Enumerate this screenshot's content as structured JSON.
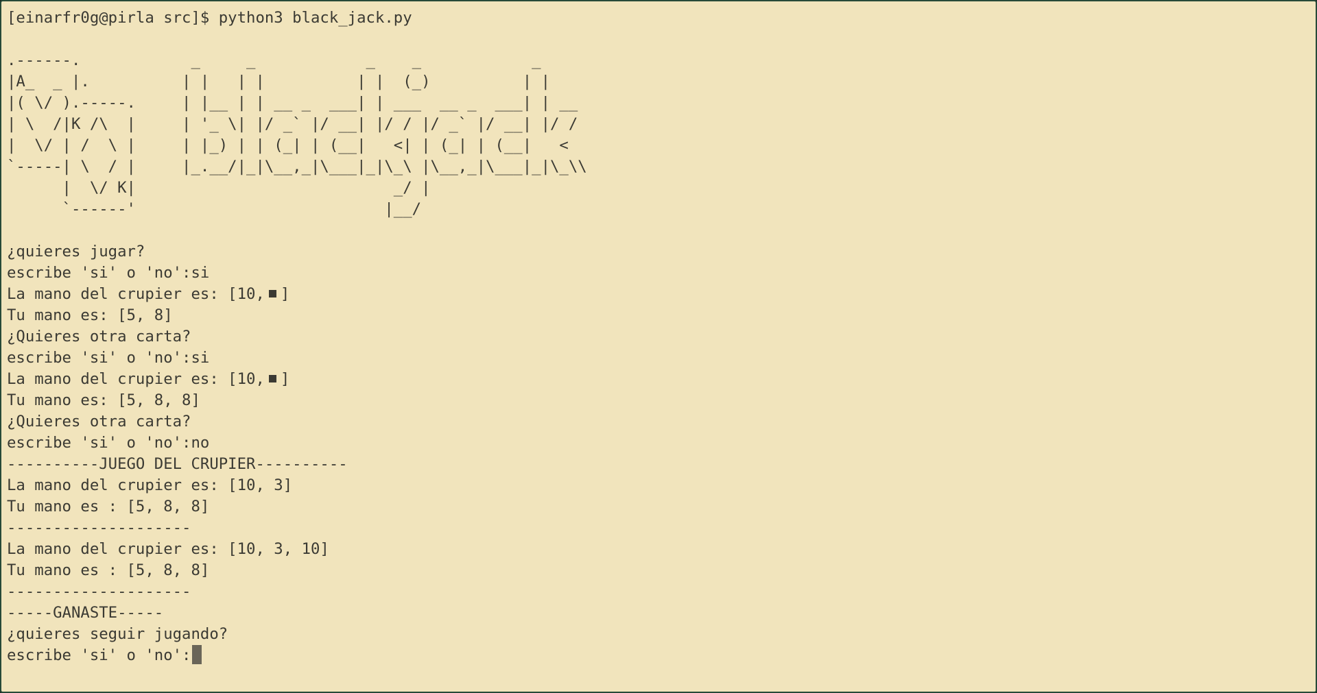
{
  "command_line": "[einarfr0g@pirla src]$ python3 black_jack.py",
  "banner": [
    ".------.            _     _            _    _            _",
    "|A_  _ |.          | |   | |          | |  (_)          | |",
    "|( \\/ ).-----.     | |__ | | __ _  ___| | ___  __ _  ___| | __",
    "| \\  /|K /\\  |     | '_ \\| |/ _` |/ __| |/ / |/ _` |/ __| |/ /",
    "|  \\/ | /  \\ |     | |_) | | (_| | (__|   <| | (_| | (__|   <",
    "`-----| \\  / |     |_.__/|_|\\__,_|\\___|_|\\_\\ |\\__,_|\\___|_|\\_\\\\",
    "      |  \\/ K|                            _/ |",
    "      `------'                           |__/"
  ],
  "session": {
    "ask_play": "¿quieres jugar?",
    "prompt_1": "escribe 'si' o 'no':si",
    "dealer_hand_1_prefix": "La mano del crupier es: [10,",
    "dealer_hand_1_suffix": "]",
    "player_hand_1": "Tu mano es: [5, 8]",
    "ask_card_1": "¿Quieres otra carta?",
    "prompt_2": "escribe 'si' o 'no':si",
    "dealer_hand_2_prefix": "La mano del crupier es: [10,",
    "dealer_hand_2_suffix": "]",
    "player_hand_2": "Tu mano es: [5, 8, 8]",
    "ask_card_2": "¿Quieres otra carta?",
    "prompt_3": "escribe 'si' o 'no':no",
    "dealer_header": "----------JUEGO DEL CRUPIER----------",
    "dealer_hand_3": "La mano del crupier es: [10, 3]",
    "player_hand_3": "Tu mano es : [5, 8, 8]",
    "separator_1": "--------------------",
    "dealer_hand_4": "La mano del crupier es: [10, 3, 10]",
    "player_hand_4": "Tu mano es : [5, 8, 8]",
    "separator_2": "--------------------",
    "result": "-----GANASTE-----",
    "ask_continue": "¿quieres seguir jugando?",
    "prompt_current": "escribe 'si' o 'no':"
  },
  "colors": {
    "terminal_background": "#f1e4bc",
    "terminal_foreground": "#3b3a33",
    "cursor": "#6a6558"
  }
}
